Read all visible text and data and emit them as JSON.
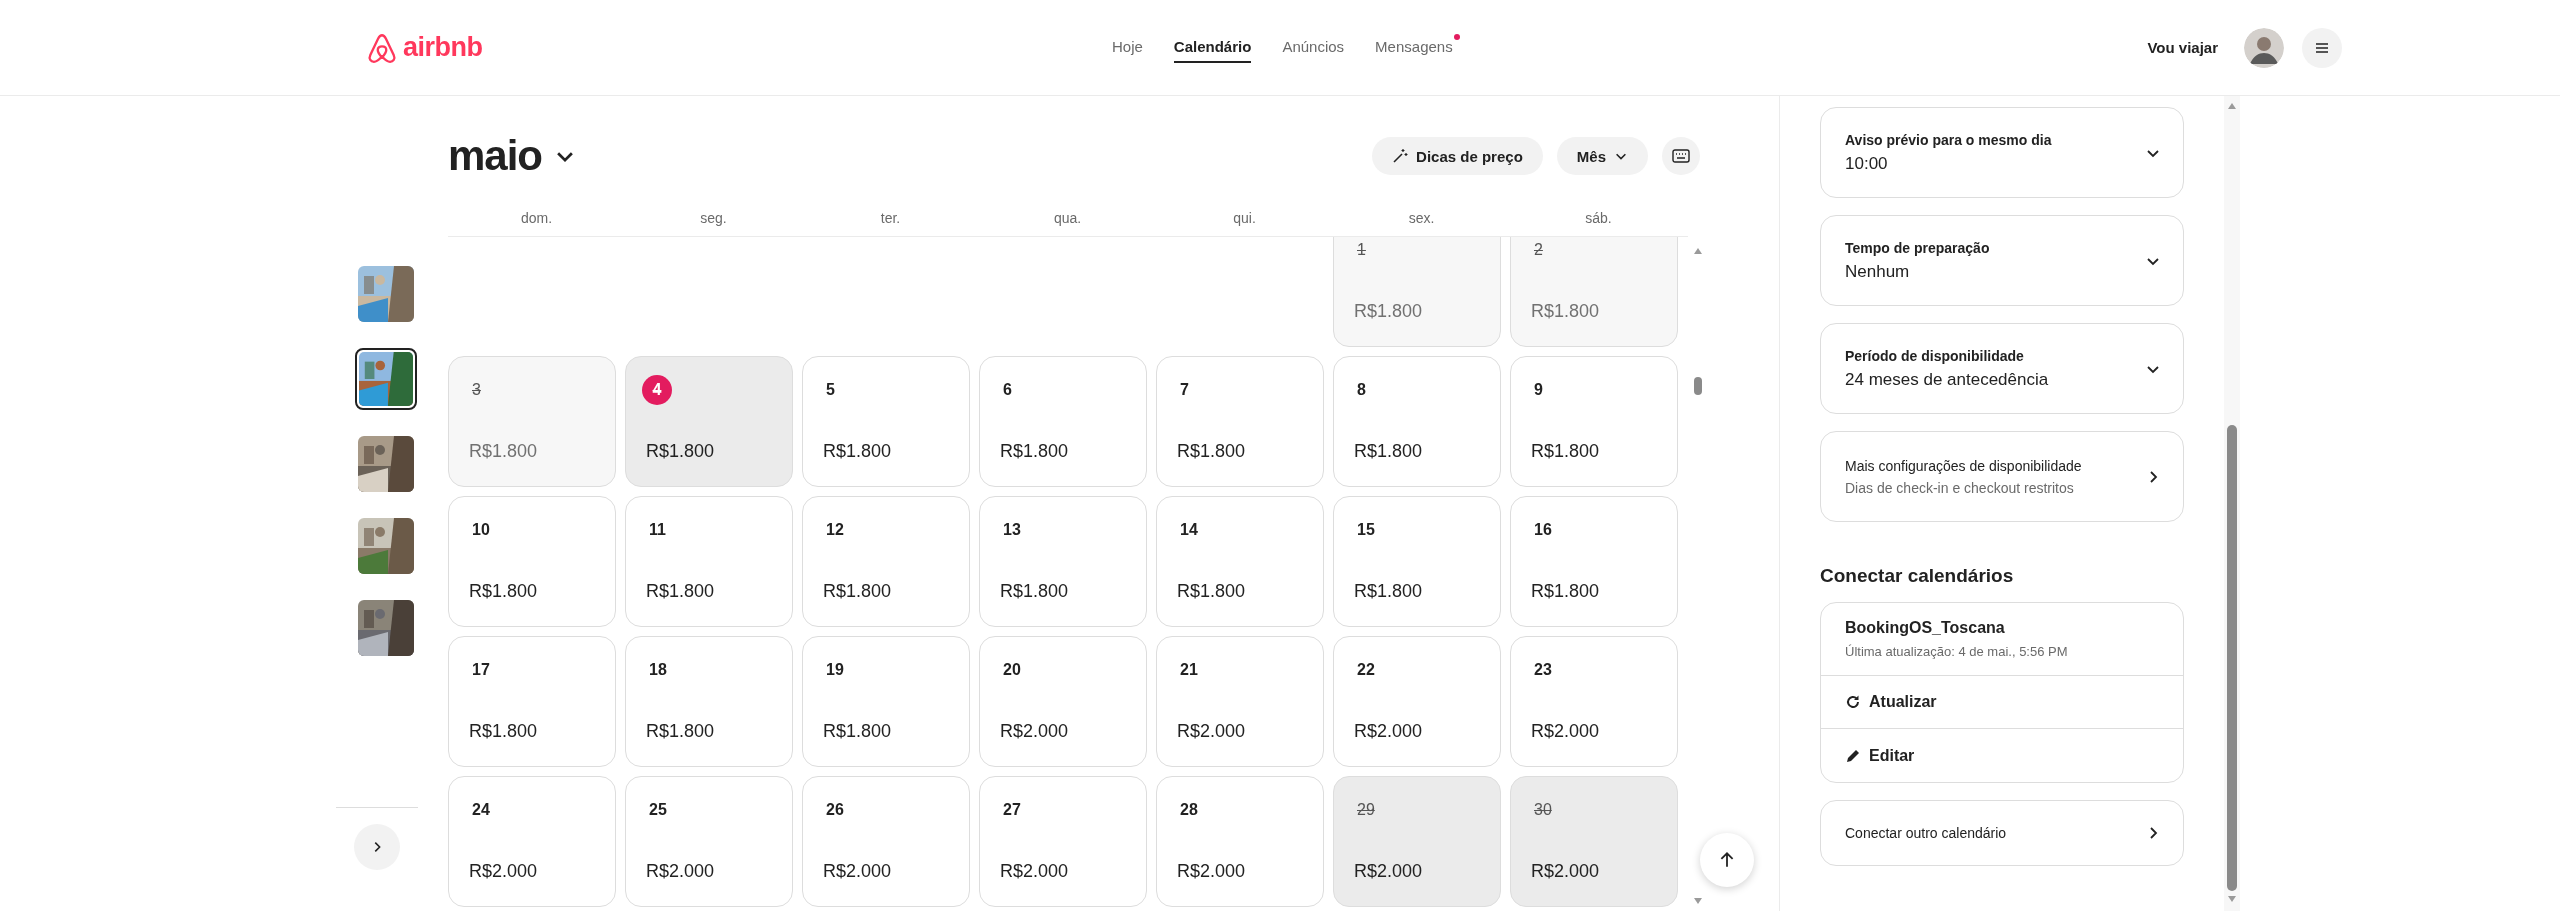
{
  "header": {
    "logo": "airbnb",
    "nav": [
      {
        "label": "Hoje",
        "selected": false,
        "notification": false
      },
      {
        "label": "Calendário",
        "selected": true,
        "notification": false
      },
      {
        "label": "Anúncios",
        "selected": false,
        "notification": false
      },
      {
        "label": "Mensagens",
        "selected": false,
        "notification": true
      }
    ],
    "switch_label": "Vou viajar"
  },
  "thumbnails": [
    {
      "selected": false
    },
    {
      "selected": true
    },
    {
      "selected": false
    },
    {
      "selected": false
    },
    {
      "selected": false
    }
  ],
  "calendar": {
    "month": "maio",
    "toolbar": [
      "Dicas de preço",
      "Mês"
    ],
    "weekdays": [
      "dom.",
      "seg.",
      "ter.",
      "qua.",
      "qui.",
      "sex.",
      "sáb."
    ],
    "weeks": [
      [
        {
          "day": "1",
          "price": "R$1.800",
          "past": true,
          "today": false,
          "blocked": false
        },
        {
          "day": "2",
          "price": "R$1.800",
          "past": true,
          "today": false,
          "blocked": false
        }
      ],
      [
        {
          "day": "3",
          "price": "R$1.800",
          "past": true,
          "today": false,
          "blocked": false
        },
        {
          "day": "4",
          "price": "R$1.800",
          "past": false,
          "today": true,
          "blocked": false
        },
        {
          "day": "5",
          "price": "R$1.800",
          "past": false,
          "today": false,
          "blocked": false
        },
        {
          "day": "6",
          "price": "R$1.800",
          "past": false,
          "today": false,
          "blocked": false
        },
        {
          "day": "7",
          "price": "R$1.800",
          "past": false,
          "today": false,
          "blocked": false
        },
        {
          "day": "8",
          "price": "R$1.800",
          "past": false,
          "today": false,
          "blocked": false
        },
        {
          "day": "9",
          "price": "R$1.800",
          "past": false,
          "today": false,
          "blocked": false
        }
      ],
      [
        {
          "day": "10",
          "price": "R$1.800",
          "past": false,
          "today": false,
          "blocked": false
        },
        {
          "day": "11",
          "price": "R$1.800",
          "past": false,
          "today": false,
          "blocked": false
        },
        {
          "day": "12",
          "price": "R$1.800",
          "past": false,
          "today": false,
          "blocked": false
        },
        {
          "day": "13",
          "price": "R$1.800",
          "past": false,
          "today": false,
          "blocked": false
        },
        {
          "day": "14",
          "price": "R$1.800",
          "past": false,
          "today": false,
          "blocked": false
        },
        {
          "day": "15",
          "price": "R$1.800",
          "past": false,
          "today": false,
          "blocked": false
        },
        {
          "day": "16",
          "price": "R$1.800",
          "past": false,
          "today": false,
          "blocked": false
        }
      ],
      [
        {
          "day": "17",
          "price": "R$1.800",
          "past": false,
          "today": false,
          "blocked": false
        },
        {
          "day": "18",
          "price": "R$1.800",
          "past": false,
          "today": false,
          "blocked": false
        },
        {
          "day": "19",
          "price": "R$1.800",
          "past": false,
          "today": false,
          "blocked": false
        },
        {
          "day": "20",
          "price": "R$2.000",
          "past": false,
          "today": false,
          "blocked": false
        },
        {
          "day": "21",
          "price": "R$2.000",
          "past": false,
          "today": false,
          "blocked": false
        },
        {
          "day": "22",
          "price": "R$2.000",
          "past": false,
          "today": false,
          "blocked": false
        },
        {
          "day": "23",
          "price": "R$2.000",
          "past": false,
          "today": false,
          "blocked": false
        }
      ],
      [
        {
          "day": "24",
          "price": "R$2.000",
          "past": false,
          "today": false,
          "blocked": false
        },
        {
          "day": "25",
          "price": "R$2.000",
          "past": false,
          "today": false,
          "blocked": false
        },
        {
          "day": "26",
          "price": "R$2.000",
          "past": false,
          "today": false,
          "blocked": false
        },
        {
          "day": "27",
          "price": "R$2.000",
          "past": false,
          "today": false,
          "blocked": false
        },
        {
          "day": "28",
          "price": "R$2.000",
          "past": false,
          "today": false,
          "blocked": false
        },
        {
          "day": "29",
          "price": "R$2.000",
          "past": false,
          "today": false,
          "blocked": true
        },
        {
          "day": "30",
          "price": "R$2.000",
          "past": false,
          "today": false,
          "blocked": true
        }
      ]
    ]
  },
  "settings": [
    {
      "kind": "dropdown",
      "title": "Aviso prévio para o mesmo dia",
      "value": "10:00"
    },
    {
      "kind": "dropdown",
      "title": "Tempo de preparação",
      "value": "Nenhum"
    },
    {
      "kind": "dropdown",
      "title": "Período de disponibilidade",
      "value": "24 meses de antecedência"
    },
    {
      "kind": "link",
      "title": "Mais configurações de disponibilidade",
      "value": "Dias de check-in e checkout restritos"
    }
  ],
  "connect": {
    "heading": "Conectar calendários",
    "calendar_name": "BookingOS_Toscana",
    "last_update": "Última atualização: 4 de mai., 5:56 PM",
    "actions": [
      {
        "kind": "refresh",
        "label": "Atualizar"
      },
      {
        "kind": "edit",
        "label": "Editar"
      }
    ],
    "other": "Conectar outro calendário"
  }
}
